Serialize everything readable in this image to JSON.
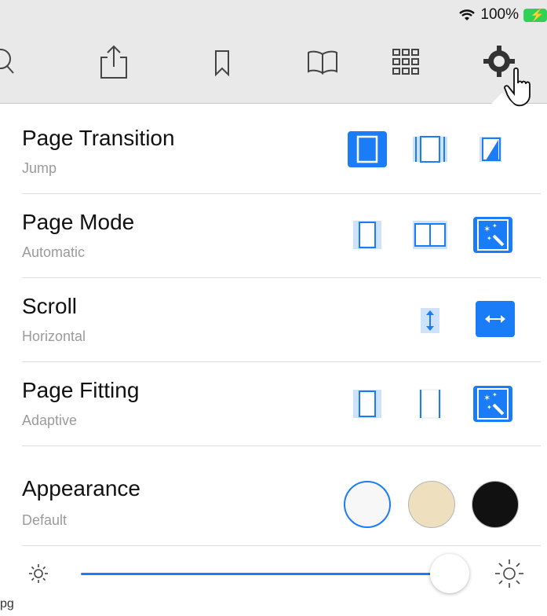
{
  "status": {
    "wifi_icon": "wifi-icon",
    "battery_percent": "100%",
    "battery_icon": "battery-charging-icon",
    "colors": {
      "battery": "#30d158"
    }
  },
  "toolbar": {
    "icons": [
      "search-icon",
      "share-icon",
      "bookmark-icon",
      "library-icon",
      "grid-icon",
      "settings-gear-icon"
    ],
    "cursor_icon": "hand-cursor-icon"
  },
  "settings": {
    "page_transition": {
      "label": "Page Transition",
      "value": "Jump",
      "options": [
        "jump-icon",
        "slide-icon",
        "curl-icon"
      ],
      "selected": 0
    },
    "page_mode": {
      "label": "Page Mode",
      "value": "Automatic",
      "options": [
        "single-page-icon",
        "two-page-icon",
        "auto-magic-icon"
      ],
      "selected": 2
    },
    "scroll": {
      "label": "Scroll",
      "value": "Horizontal",
      "options": [
        "vertical-scroll-icon",
        "horizontal-scroll-icon"
      ],
      "selected": 1
    },
    "page_fitting": {
      "label": "Page Fitting",
      "value": "Adaptive",
      "options": [
        "fit-page-icon",
        "fit-width-icon",
        "adaptive-magic-icon"
      ],
      "selected": 2
    },
    "appearance": {
      "label": "Appearance",
      "value": "Default",
      "options": [
        "default-theme",
        "sepia-theme",
        "night-theme"
      ],
      "colors": [
        "#f7f7f7",
        "#eedfbf",
        "#111111"
      ],
      "selected": 0
    }
  },
  "brightness": {
    "level": 0.95,
    "low_icon": "sun-small-icon",
    "high_icon": "sun-large-icon"
  },
  "footer": {
    "fragment": "pg"
  },
  "colors": {
    "accent": "#1a7cf7",
    "accent_light": "#cfe2fb"
  }
}
